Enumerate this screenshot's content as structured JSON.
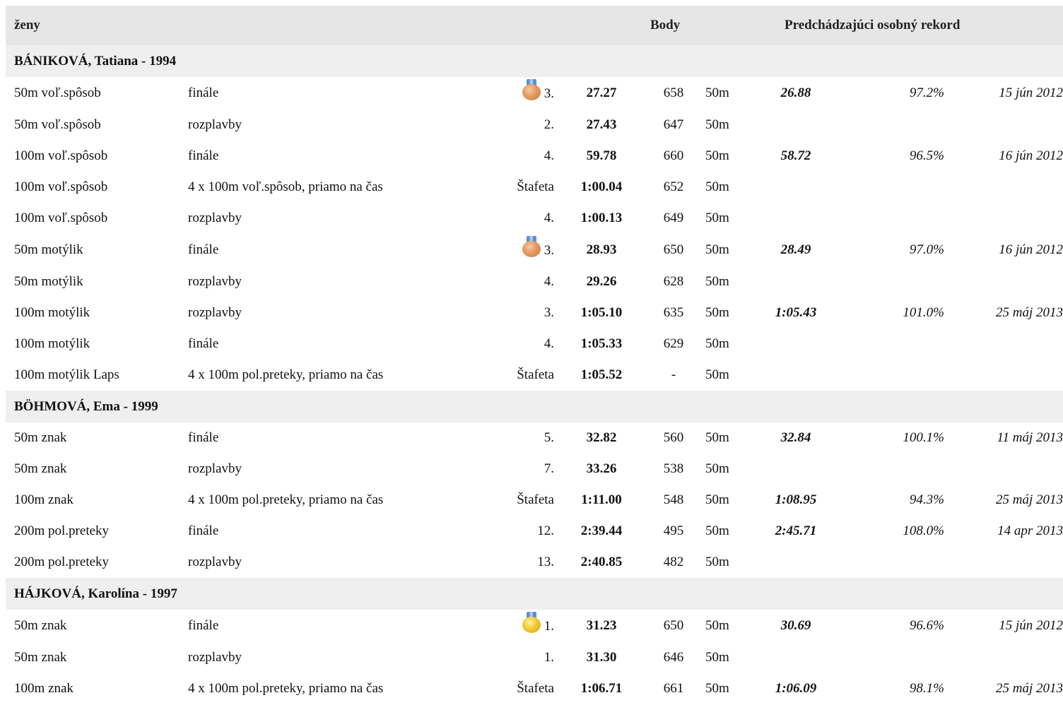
{
  "header": {
    "category": "ženy",
    "points_label": "Body",
    "pb_label": "Predchádzajúci osobný rekord"
  },
  "colors": {
    "header_bg": "#e6e6e6",
    "swimmer_bg": "#efefef",
    "bronze": "#e59a63",
    "gold": "#f2c92c",
    "ribbon": "#5b8fd6"
  },
  "swimmers": [
    {
      "name": "BÁNIKOVÁ, Tatiana - 1994",
      "results": [
        {
          "event": "50m voľ.spôsob",
          "round": "finále",
          "medal": "bronze-medal-icon",
          "place": "3.",
          "time": "27.27",
          "points": "658",
          "course": "50m",
          "pb": "26.88",
          "pct": "97.2%",
          "date": "15 jún 2012"
        },
        {
          "event": "50m voľ.spôsob",
          "round": "rozplavby",
          "medal": "",
          "place": "2.",
          "time": "27.43",
          "points": "647",
          "course": "50m",
          "pb": "",
          "pct": "",
          "date": ""
        },
        {
          "event": "100m voľ.spôsob",
          "round": "finále",
          "medal": "",
          "place": "4.",
          "time": "59.78",
          "points": "660",
          "course": "50m",
          "pb": "58.72",
          "pct": "96.5%",
          "date": "16 jún 2012"
        },
        {
          "event": "100m voľ.spôsob",
          "round": "4 x 100m voľ.spôsob, priamo na čas",
          "medal": "",
          "place": "Štafeta",
          "time": "1:00.04",
          "points": "652",
          "course": "50m",
          "pb": "",
          "pct": "",
          "date": ""
        },
        {
          "event": "100m voľ.spôsob",
          "round": "rozplavby",
          "medal": "",
          "place": "4.",
          "time": "1:00.13",
          "points": "649",
          "course": "50m",
          "pb": "",
          "pct": "",
          "date": ""
        },
        {
          "event": "50m motýlik",
          "round": "finále",
          "medal": "bronze-medal-icon",
          "place": "3.",
          "time": "28.93",
          "points": "650",
          "course": "50m",
          "pb": "28.49",
          "pct": "97.0%",
          "date": "16 jún 2012"
        },
        {
          "event": "50m motýlik",
          "round": "rozplavby",
          "medal": "",
          "place": "4.",
          "time": "29.26",
          "points": "628",
          "course": "50m",
          "pb": "",
          "pct": "",
          "date": ""
        },
        {
          "event": "100m motýlik",
          "round": "rozplavby",
          "medal": "",
          "place": "3.",
          "time": "1:05.10",
          "points": "635",
          "course": "50m",
          "pb": "1:05.43",
          "pct": "101.0%",
          "date": "25 máj 2013"
        },
        {
          "event": "100m motýlik",
          "round": "finále",
          "medal": "",
          "place": "4.",
          "time": "1:05.33",
          "points": "629",
          "course": "50m",
          "pb": "",
          "pct": "",
          "date": ""
        },
        {
          "event": "100m motýlik Laps",
          "round": "4 x 100m pol.preteky, priamo na čas",
          "medal": "",
          "place": "Štafeta",
          "time": "1:05.52",
          "points": "-",
          "course": "50m",
          "pb": "",
          "pct": "",
          "date": ""
        }
      ]
    },
    {
      "name": "BÖHMOVÁ, Ema - 1999",
      "results": [
        {
          "event": "50m znak",
          "round": "finále",
          "medal": "",
          "place": "5.",
          "time": "32.82",
          "points": "560",
          "course": "50m",
          "pb": "32.84",
          "pct": "100.1%",
          "date": "11 máj 2013"
        },
        {
          "event": "50m znak",
          "round": "rozplavby",
          "medal": "",
          "place": "7.",
          "time": "33.26",
          "points": "538",
          "course": "50m",
          "pb": "",
          "pct": "",
          "date": ""
        },
        {
          "event": "100m znak",
          "round": "4 x 100m pol.preteky, priamo na čas",
          "medal": "",
          "place": "Štafeta",
          "time": "1:11.00",
          "points": "548",
          "course": "50m",
          "pb": "1:08.95",
          "pct": "94.3%",
          "date": "25 máj 2013"
        },
        {
          "event": "200m pol.preteky",
          "round": "finále",
          "medal": "",
          "place": "12.",
          "time": "2:39.44",
          "points": "495",
          "course": "50m",
          "pb": "2:45.71",
          "pct": "108.0%",
          "date": "14 apr 2013"
        },
        {
          "event": "200m pol.preteky",
          "round": "rozplavby",
          "medal": "",
          "place": "13.",
          "time": "2:40.85",
          "points": "482",
          "course": "50m",
          "pb": "",
          "pct": "",
          "date": ""
        }
      ]
    },
    {
      "name": "HÁJKOVÁ, Karolína - 1997",
      "results": [
        {
          "event": "50m znak",
          "round": "finále",
          "medal": "gold-medal-icon",
          "place": "1.",
          "time": "31.23",
          "points": "650",
          "course": "50m",
          "pb": "30.69",
          "pct": "96.6%",
          "date": "15 jún 2012"
        },
        {
          "event": "50m znak",
          "round": "rozplavby",
          "medal": "",
          "place": "1.",
          "time": "31.30",
          "points": "646",
          "course": "50m",
          "pb": "",
          "pct": "",
          "date": ""
        },
        {
          "event": "100m znak",
          "round": "4 x 100m pol.preteky, priamo na čas",
          "medal": "",
          "place": "Štafeta",
          "time": "1:06.71",
          "points": "661",
          "course": "50m",
          "pb": "1:06.09",
          "pct": "98.1%",
          "date": "25 máj 2013"
        }
      ]
    }
  ]
}
